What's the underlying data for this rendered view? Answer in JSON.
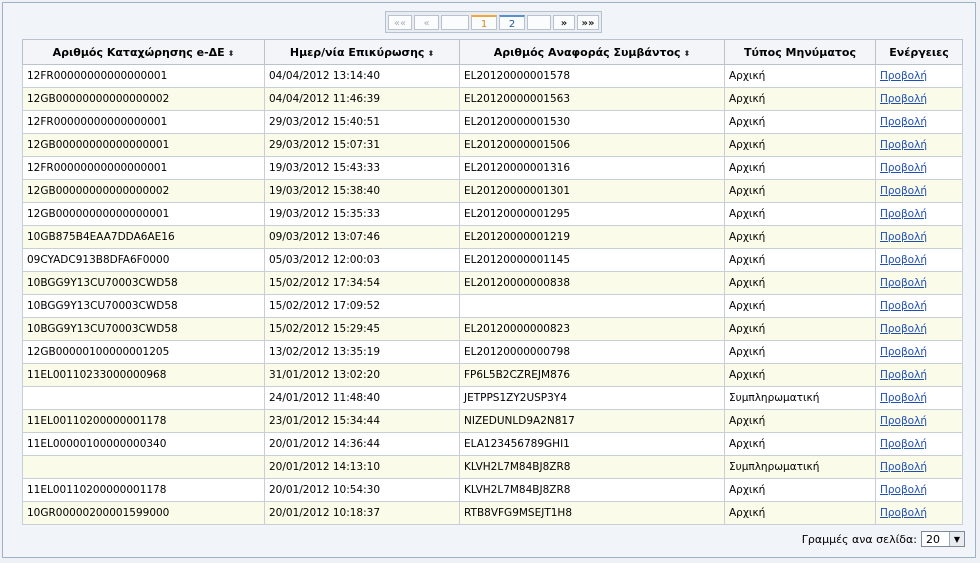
{
  "pager": {
    "first": "««",
    "prev": "«",
    "pages": [
      "1",
      "2"
    ],
    "next": "»",
    "last": "»»"
  },
  "table": {
    "headers": [
      "Αριθμός Καταχώρησης e-ΔΕ",
      "Ημερ/νία Επικύρωσης",
      "Αριθμός Αναφοράς Συμβάντος",
      "Τύπος Μηνύματος",
      "Ενέργειες"
    ],
    "sort_icon": "⬍",
    "action_label": "Προβολή",
    "rows": [
      [
        "12FR00000000000000001",
        "04/04/2012 13:14:40",
        "EL20120000001578",
        "Αρχική"
      ],
      [
        "12GB00000000000000002",
        "04/04/2012 11:46:39",
        "EL20120000001563",
        "Αρχική"
      ],
      [
        "12FR00000000000000001",
        "29/03/2012 15:40:51",
        "EL20120000001530",
        "Αρχική"
      ],
      [
        "12GB00000000000000001",
        "29/03/2012 15:07:31",
        "EL20120000001506",
        "Αρχική"
      ],
      [
        "12FR00000000000000001",
        "19/03/2012 15:43:33",
        "EL20120000001316",
        "Αρχική"
      ],
      [
        "12GB00000000000000002",
        "19/03/2012 15:38:40",
        "EL20120000001301",
        "Αρχική"
      ],
      [
        "12GB00000000000000001",
        "19/03/2012 15:35:33",
        "EL20120000001295",
        "Αρχική"
      ],
      [
        "10GB875B4EAA7DDA6AE16",
        "09/03/2012 13:07:46",
        "EL20120000001219",
        "Αρχική"
      ],
      [
        "09CYADC913B8DFA6F0000",
        "05/03/2012 12:00:03",
        "EL20120000001145",
        "Αρχική"
      ],
      [
        "10BGG9Y13CU70003CWD58",
        "15/02/2012 17:34:54",
        "EL20120000000838",
        "Αρχική"
      ],
      [
        "10BGG9Y13CU70003CWD58",
        "15/02/2012 17:09:52",
        "",
        "Αρχική"
      ],
      [
        "10BGG9Y13CU70003CWD58",
        "15/02/2012 15:29:45",
        "EL20120000000823",
        "Αρχική"
      ],
      [
        "12GB00000100000001205",
        "13/02/2012 13:35:19",
        "EL20120000000798",
        "Αρχική"
      ],
      [
        "11EL00110233000000968",
        "31/01/2012 13:02:20",
        "FP6L5B2CZREJM876",
        "Αρχική"
      ],
      [
        "",
        "24/01/2012 11:48:40",
        "JETPPS1ZY2USP3Y4",
        "Συμπληρωματική"
      ],
      [
        "11EL00110200000001178",
        "23/01/2012 15:34:44",
        "NIZEDUNLD9A2N817",
        "Αρχική"
      ],
      [
        "11EL00000100000000340",
        "20/01/2012 14:36:44",
        "ELA123456789GHI1",
        "Αρχική"
      ],
      [
        "",
        "20/01/2012 14:13:10",
        "KLVH2L7M84BJ8ZR8",
        "Συμπληρωματική"
      ],
      [
        "11EL00110200000001178",
        "20/01/2012 10:54:30",
        "KLVH2L7M84BJ8ZR8",
        "Αρχική"
      ],
      [
        "10GR00000200001599000",
        "20/01/2012 10:18:37",
        "RTB8VFG9MSEJT1H8",
        "Αρχική"
      ]
    ]
  },
  "footer": {
    "rows_per_page_label": "Γραμμές ανα σελίδα:",
    "rows_per_page_value": "20"
  }
}
